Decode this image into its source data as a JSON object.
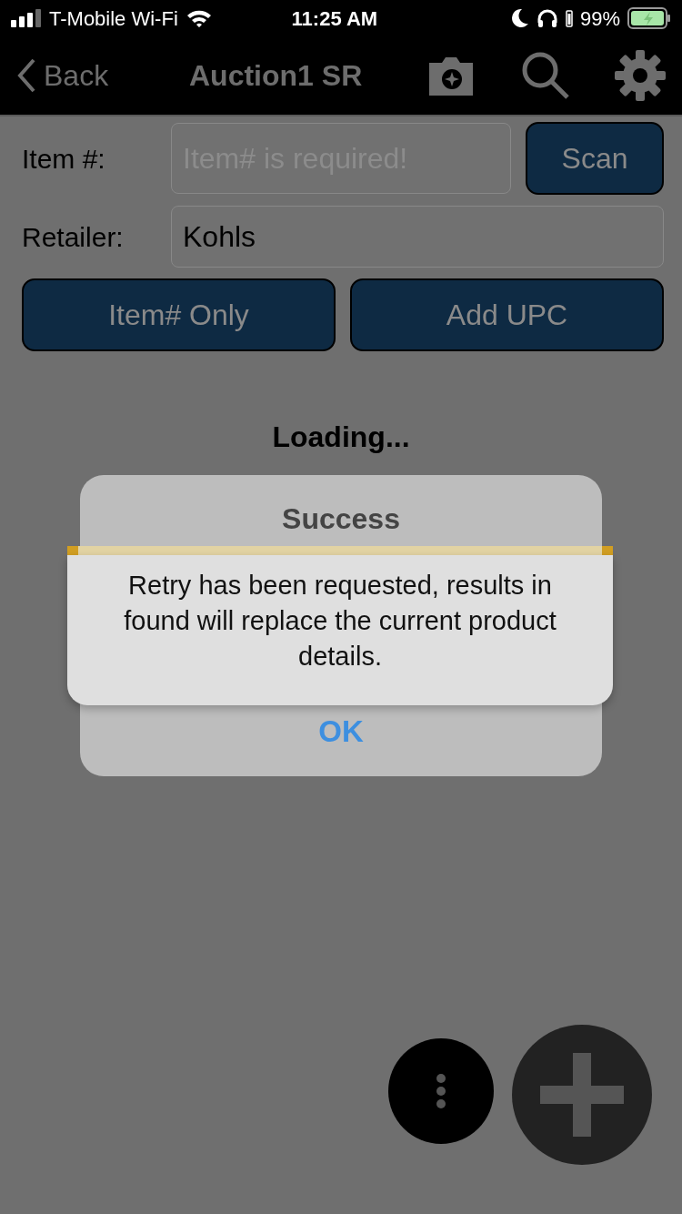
{
  "status_bar": {
    "carrier": "T-Mobile Wi-Fi",
    "time": "11:25 AM",
    "battery_percent": "99%"
  },
  "nav": {
    "back_label": "Back",
    "title": "Auction1 SR"
  },
  "form": {
    "item_label": "Item #:",
    "item_placeholder": "Item# is required!",
    "scan_label": "Scan",
    "retailer_label": "Retailer:",
    "retailer_value": "Kohls",
    "buttons": [
      "Item# Only",
      "Add UPC"
    ]
  },
  "loading_text": "Loading...",
  "alert": {
    "title": "Success",
    "button": "OK"
  },
  "toast": {
    "message": "Retry has been requested, results in found will replace the current product details."
  }
}
